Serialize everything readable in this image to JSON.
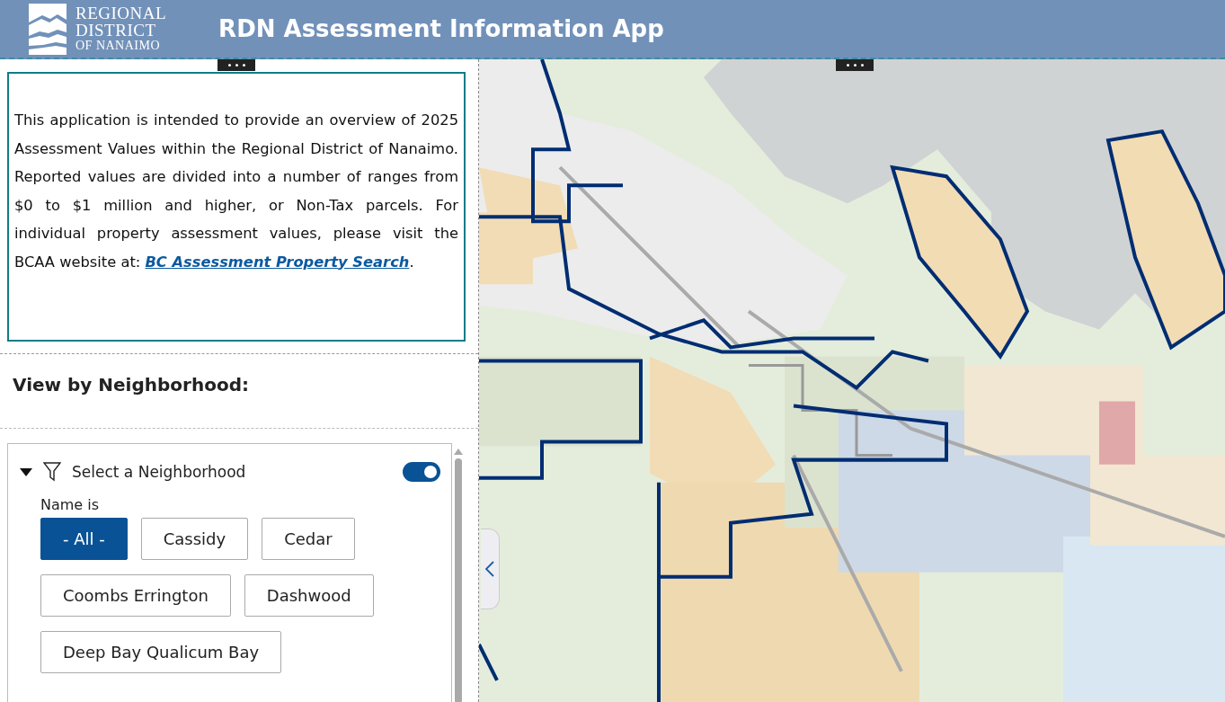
{
  "header": {
    "logo_lines": [
      "REGIONAL",
      "DISTRICT",
      "OF NANAIMO"
    ],
    "title": "RDN Assessment Information App"
  },
  "intro": {
    "text": "This application is intended to provide an overview of 2025 Assessment Values within the Regional District of Nanaimo. Reported values are divided into a number of ranges from $0 to $1 million and higher, or Non-Tax parcels. For individual property assessment values, please visit the BCAA website at:",
    "link": "BC Assessment Property Search",
    "link_suffix": "."
  },
  "section_heading": "View by Neighborhood:",
  "filter": {
    "title": "Select a Neighborhood",
    "expanded": true,
    "on": true,
    "label": "Name is",
    "options": [
      {
        "label": "- All -",
        "selected": true
      },
      {
        "label": "Cassidy",
        "selected": false
      },
      {
        "label": "Cedar",
        "selected": false
      },
      {
        "label": "Coombs Errington",
        "selected": false
      },
      {
        "label": "Dashwood",
        "selected": false
      },
      {
        "label": "Deep Bay Qualicum Bay",
        "selected": false
      }
    ]
  }
}
